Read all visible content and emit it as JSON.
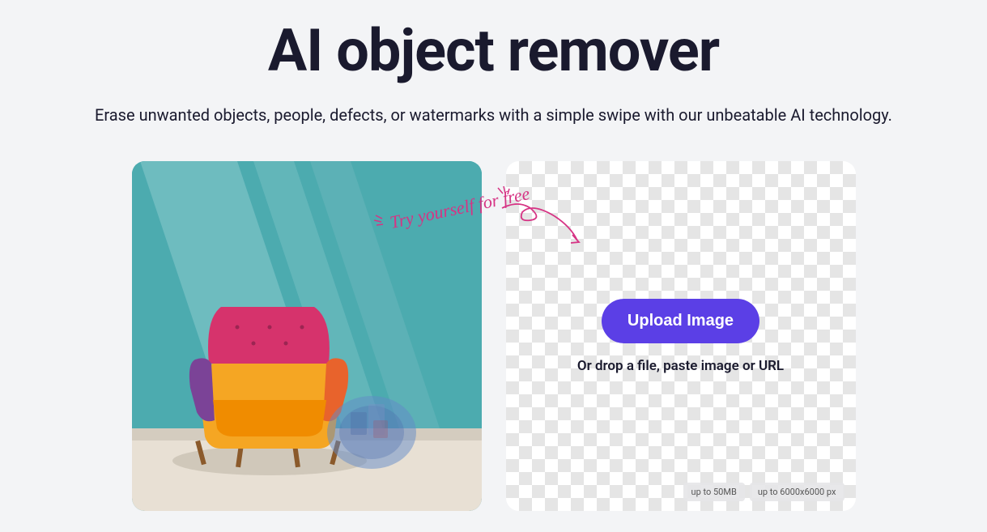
{
  "header": {
    "title": "AI object remover",
    "subtitle": "Erase unwanted objects, people, defects, or watermarks with a simple swipe with our unbeatable AI technology."
  },
  "callout": {
    "text": "Try yourself for free"
  },
  "upload": {
    "button_label": "Upload Image",
    "drop_text": "Or drop a file, paste image or URL",
    "limits": {
      "size": "up to 50MB",
      "dimensions": "up to 6000x6000 px"
    }
  },
  "colors": {
    "accent": "#5B3FE6",
    "callout": "#d63384",
    "text": "#1a1a2e",
    "background": "#f3f4f6"
  }
}
